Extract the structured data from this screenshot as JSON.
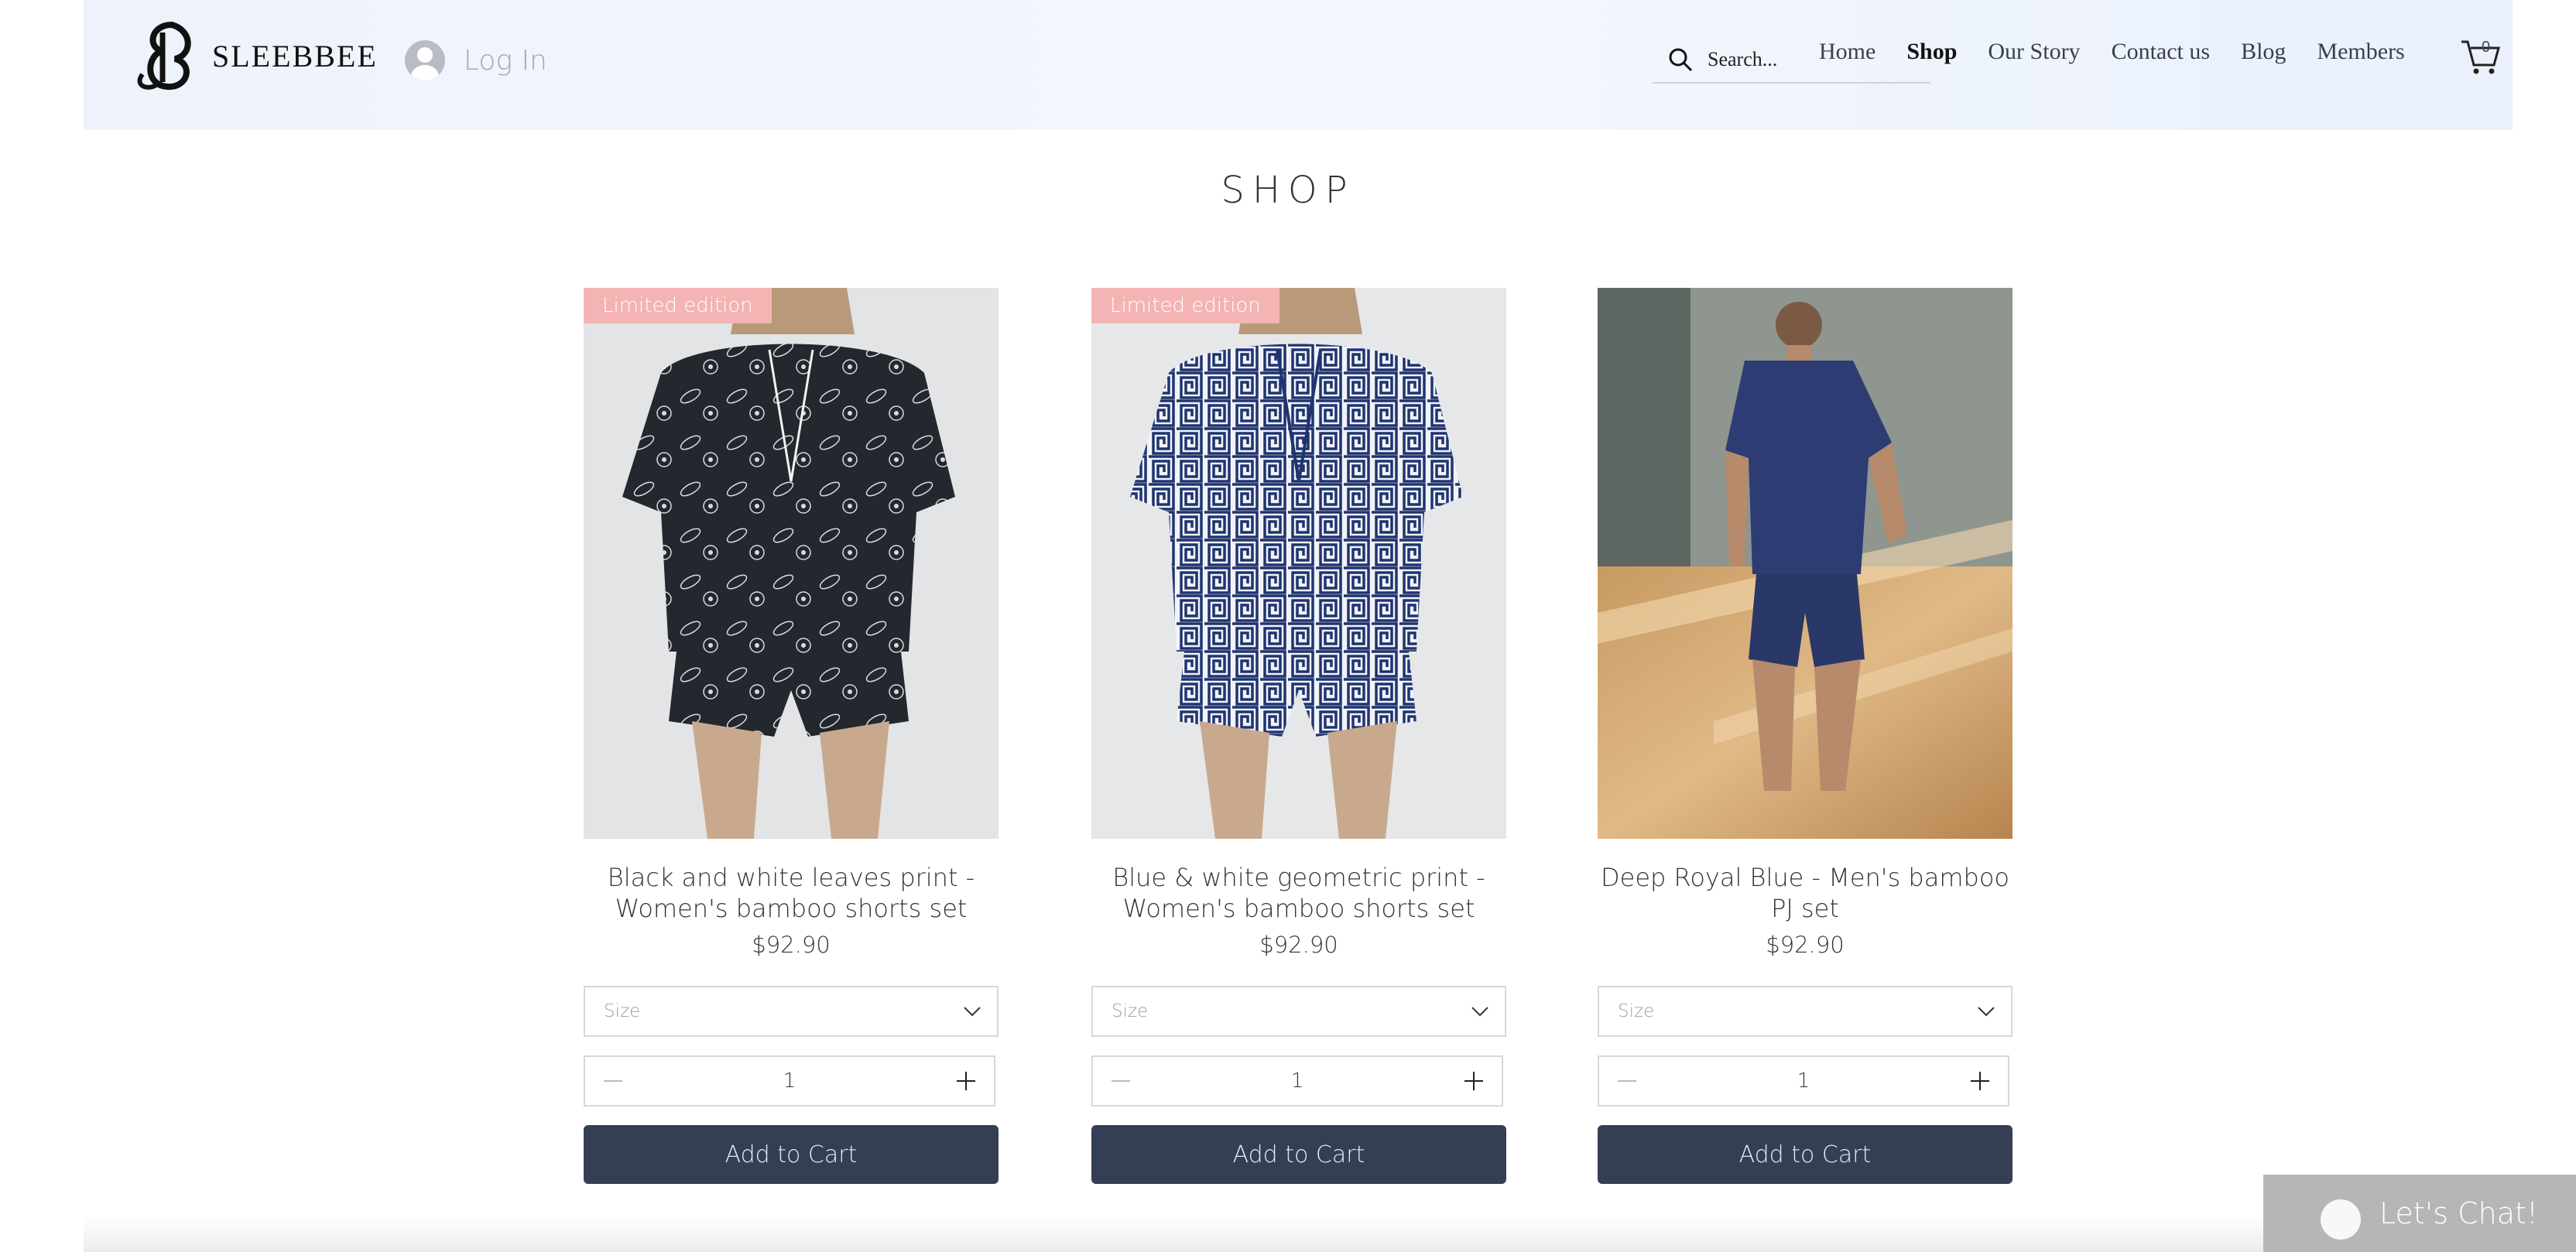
{
  "header": {
    "brand": "SLEEBBEE",
    "login_label": "Log In",
    "search_placeholder": "Search...",
    "nav": [
      "Home",
      "Shop",
      "Our Story",
      "Contact us",
      "Blog",
      "Members"
    ],
    "active_nav": "Shop",
    "cart_count": "0"
  },
  "page": {
    "title": "SHOP"
  },
  "products": [
    {
      "ribbon": "Limited edition",
      "name": "Black and white leaves print - Women's bamboo shorts set",
      "price": "$92.90",
      "size_placeholder": "Size",
      "quantity": "1",
      "add_label": "Add to Cart"
    },
    {
      "ribbon": "Limited edition",
      "name": "Blue & white geometric print - Women's bamboo shorts set",
      "price": "$92.90",
      "size_placeholder": "Size",
      "quantity": "1",
      "add_label": "Add to Cart"
    },
    {
      "ribbon": "",
      "name": "Deep Royal Blue - Men's bamboo PJ set",
      "price": "$92.90",
      "size_placeholder": "Size",
      "quantity": "1",
      "add_label": "Add to Cart"
    }
  ],
  "chat": {
    "label": "Let's Chat!"
  },
  "colors": {
    "header_bg": "#eef3fb",
    "ribbon": "#f4b4b4",
    "add_button": "#343f55",
    "chat_bg": "#b6b6b6"
  },
  "icons": [
    "search-icon",
    "cart-icon",
    "avatar-icon",
    "chevron-down-icon",
    "minus-icon",
    "plus-icon",
    "chat-icon"
  ]
}
